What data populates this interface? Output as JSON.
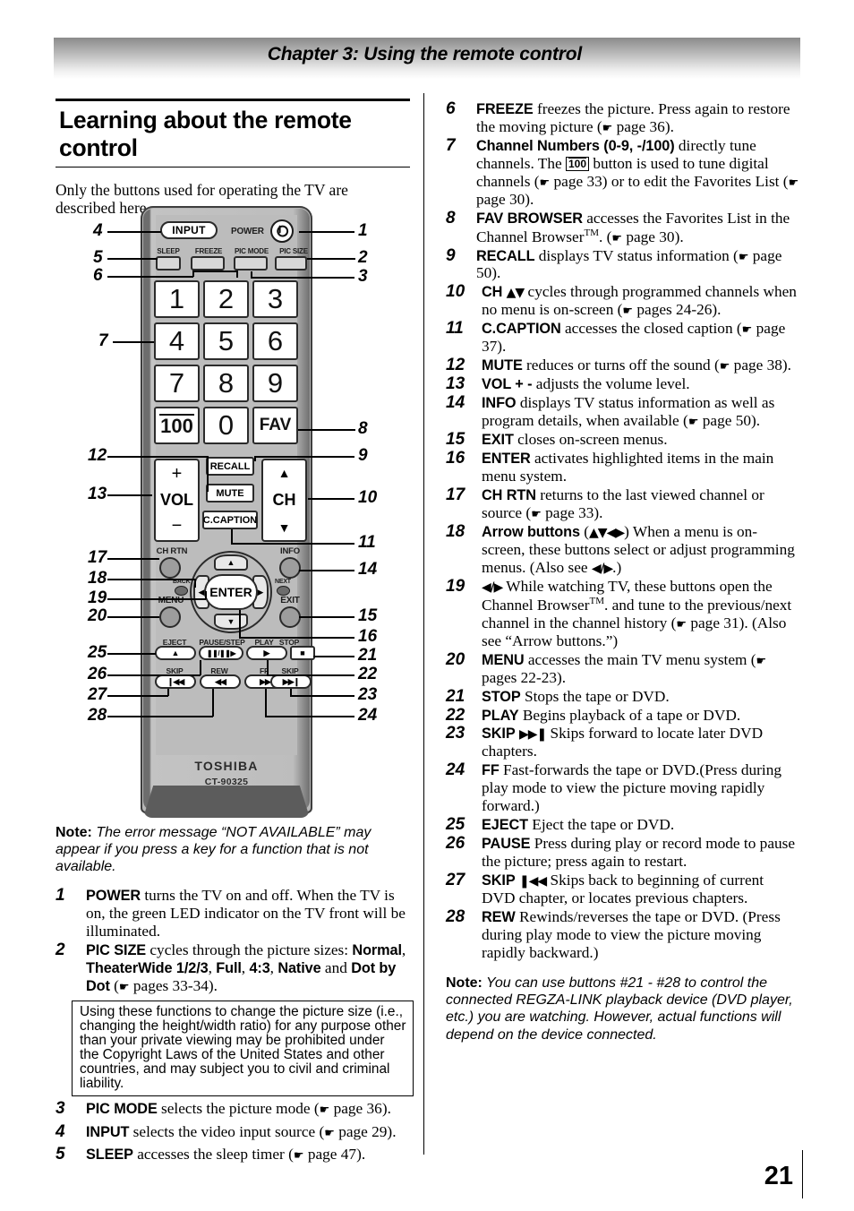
{
  "header": {
    "chapter": "Chapter 3: Using the remote control"
  },
  "page": {
    "number": "21"
  },
  "left": {
    "title": "Learning about the remote control",
    "intro": "Only the buttons used for operating the TV are described here.",
    "note": {
      "label": "Note:",
      "text": " The error message “NOT AVAILABLE” may appear if you press a key for a function that is not available."
    },
    "warning_box": "Using these functions to change the picture size (i.e., changing the height/width ratio) for any purpose other than your private viewing may be prohibited under the Copyright Laws of the United States and other countries, and may subject you to civil and criminal liability."
  },
  "remote": {
    "brand": "TOSHIBA",
    "model": "CT-90325",
    "buttons": {
      "input": "INPUT",
      "power_label": "POWER",
      "power_icon": "power-icon",
      "sleep": "SLEEP",
      "freeze": "FREEZE",
      "pic_mode": "PIC MODE",
      "pic_size": "PIC SIZE",
      "num_1": "1",
      "num_2": "2",
      "num_3": "3",
      "num_4": "4",
      "num_5": "5",
      "num_6": "6",
      "num_7": "7",
      "num_8": "8",
      "num_9": "9",
      "num_100": "100",
      "num_0": "0",
      "fav": "FAV",
      "vol": "VOL",
      "vol_plus": "+",
      "vol_minus": "−",
      "recall": "RECALL",
      "mute": "MUTE",
      "c_caption": "C.CAPTION",
      "ch": "CH",
      "ch_up": "▲",
      "ch_down": "▼",
      "ch_rtn": "CH RTN",
      "info": "INFO",
      "back": "BACK",
      "next": "NEXT",
      "menu": "MENU",
      "exit": "EXIT",
      "enter": "ENTER",
      "eject_label": "EJECT",
      "eject_icon": "▲",
      "pause_label": "PAUSE/STEP",
      "pause_icon": "❚❚/❚❚▶",
      "play_label": "PLAY",
      "play_icon": "▶",
      "stop_label": "STOP",
      "stop_icon": "■",
      "skip_back_label": "SKIP",
      "skip_back_icon": "❙◀◀",
      "rew_label": "REW",
      "rew_icon": "◀◀",
      "ff_label": "FF",
      "ff_icon": "▶▶",
      "skip_fwd_label": "SKIP",
      "skip_fwd_icon": "▶▶❙"
    },
    "callouts": [
      "1",
      "2",
      "3",
      "4",
      "5",
      "6",
      "7",
      "8",
      "9",
      "10",
      "11",
      "12",
      "13",
      "14",
      "15",
      "16",
      "17",
      "18",
      "19",
      "20",
      "21",
      "22",
      "23",
      "24",
      "25",
      "26",
      "27",
      "28"
    ]
  },
  "items": [
    {
      "n": "1",
      "kw": "POWER",
      "text": " turns the TV on and off. When the TV is on, the green LED indicator on the TV front will be illuminated."
    },
    {
      "n": "2",
      "kw": "PIC SIZE",
      "text": " cycles through the picture sizes: "
    },
    {
      "n": "3",
      "kw": "PIC MODE",
      "text": " selects the picture mode (",
      "ref": " page 36)."
    },
    {
      "n": "4",
      "kw": "INPUT",
      "text": " selects the video input source (",
      "ref": " page 29)."
    },
    {
      "n": "5",
      "kw": "SLEEP",
      "text": " accesses the sleep timer (",
      "ref": " page 47)."
    },
    {
      "n": "6",
      "kw": "FREEZE",
      "text": " freezes the picture. Press again to restore the moving picture (",
      "ref": " page 36)."
    },
    {
      "n": "7",
      "kw": "Channel Numbers (0-9, -/100)",
      "text": " directly tune channels. The "
    },
    {
      "n": "8",
      "kw": "FAV BROWSER",
      "text": " accesses the Favorites List in the Channel Browser",
      "ref": " page 30)."
    },
    {
      "n": "9",
      "kw": "RECALL",
      "text": " displays TV status information (",
      "ref": " page 50)."
    },
    {
      "n": "10",
      "kw": "CH",
      "text": " cycles through programmed channels when no menu is on-screen (",
      "ref": " pages 24-26)."
    },
    {
      "n": "11",
      "kw": "C.CAPTION",
      "text": " accesses the closed caption (",
      "ref": " page 37)."
    },
    {
      "n": "12",
      "kw": "MUTE",
      "text": " reduces or turns off the sound (",
      "ref": " page 38)."
    },
    {
      "n": "13",
      "kw": "VOL + -",
      "text": " adjusts the volume level."
    },
    {
      "n": "14",
      "kw": "INFO",
      "text": " displays TV status information as well as program details, when available (",
      "ref": " page 50)."
    },
    {
      "n": "15",
      "kw": "EXIT",
      "text": " closes on-screen menus."
    },
    {
      "n": "16",
      "kw": "ENTER",
      "text": " activates highlighted items in the main menu system."
    },
    {
      "n": "17",
      "kw": "CH RTN",
      "text": " returns to the last viewed channel or source (",
      "ref": " page 33)."
    },
    {
      "n": "18",
      "kw": "Arrow buttons",
      "text": " When a menu is on-screen, these buttons select or adjust programming menus. (Also see "
    },
    {
      "n": "19",
      "kw": "",
      "text": " While watching TV, these buttons open the Channel Browser"
    },
    {
      "n": "20",
      "kw": "MENU",
      "text": " accesses the main TV menu system (",
      "ref": " pages 22-23)."
    },
    {
      "n": "21",
      "kw": "STOP",
      "text": " Stops the tape or DVD."
    },
    {
      "n": "22",
      "kw": "PLAY",
      "text": " Begins playback of a tape or DVD."
    },
    {
      "n": "23",
      "kw": "SKIP",
      "text": " Skips forward to locate later DVD chapters."
    },
    {
      "n": "24",
      "kw": "FF",
      "text": " Fast-forwards the tape or DVD.(Press during play mode to view the picture moving rapidly forward.)"
    },
    {
      "n": "25",
      "kw": "EJECT",
      "text": " Eject the tape or DVD."
    },
    {
      "n": "26",
      "kw": "PAUSE",
      "text": " Press during play or record mode to pause the picture; press again to restart."
    },
    {
      "n": "27",
      "kw": "SKIP",
      "text": " Skips back to beginning of current DVD chapter, or locates previous chapters."
    },
    {
      "n": "28",
      "kw": "REW",
      "text": " Rewinds/reverses the tape or DVD. (Press during play mode to view the picture moving rapidly backward.)"
    }
  ],
  "item2_sizes": [
    "Normal",
    "TheaterWide 1/2/3",
    "Full",
    "4:3",
    "Native",
    "Dot by Dot"
  ],
  "item2_tail": " pages 33-34).",
  "item7": {
    "after_key": " button is used to tune digital channels (",
    "ref1": " page 33) or to edit the Favorites List (",
    "ref2": " page 30)."
  },
  "item19": {
    "tail": ". and tune to the previous/next channel in the channel history (",
    "ref": " page 31). (Also see “Arrow buttons.”)"
  },
  "right_note": {
    "label": "Note:",
    "text": " You can use buttons #21 - #28 to control the connected REGZA-LINK playback device (DVD player, etc.) you are watching. However, actual functions will depend on the device connected."
  }
}
